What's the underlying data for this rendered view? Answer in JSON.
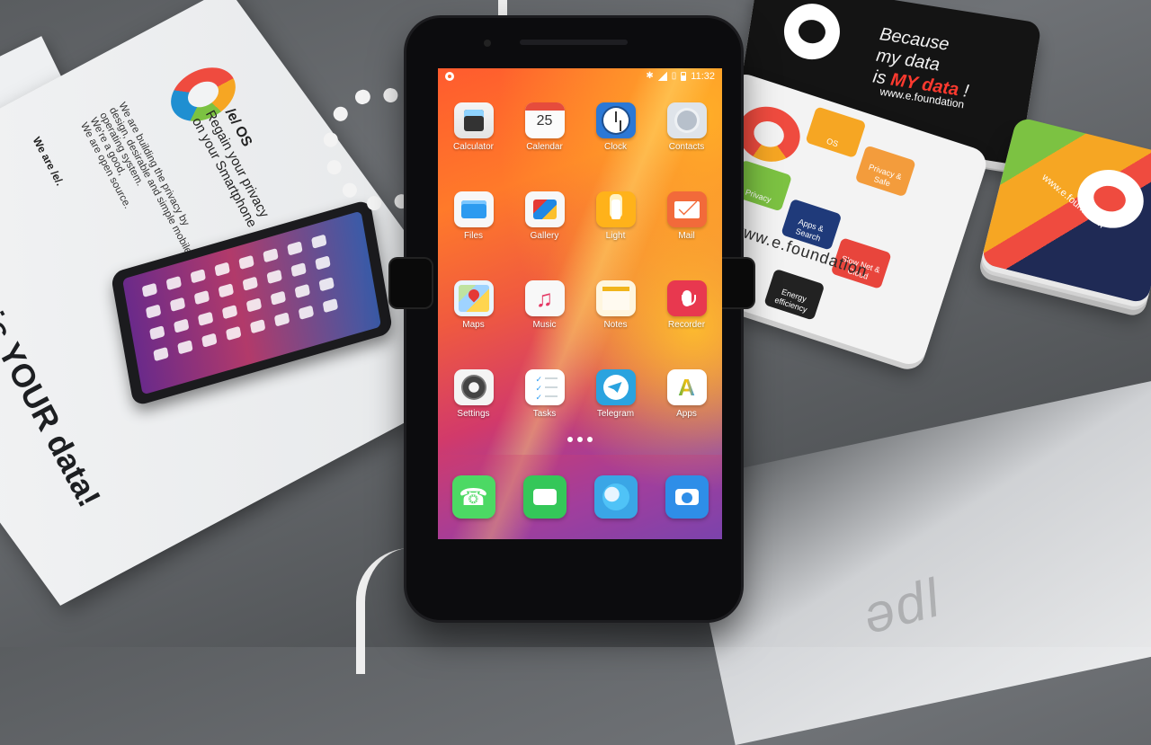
{
  "scene": {
    "description_free": true
  },
  "brochure": {
    "title": "/e/ OS",
    "slogan": "Regain your privacy\non your Smartphone",
    "body": "We are building the privacy by\ndesign, desirable and simple mobile\noperating system.\nWe're a good,\nWe are open source.",
    "we_are": "We are /e/.",
    "big_text": "is YOUR data!"
  },
  "sticker_black": {
    "handwriting_line1": "Because",
    "handwriting_line2": "my data",
    "handwriting_line3_prefix": "is",
    "handwriting_highlight": "MY data",
    "handwriting_suffix": "!",
    "url": "www.e.foundation"
  },
  "sticker_white": {
    "url": "www.e.foundation",
    "tiles": [
      {
        "label": "OS",
        "color": "#f6a623"
      },
      {
        "label": "Privacy & Safe",
        "color": "#f39c3c"
      },
      {
        "label": "Privacy",
        "color": "#7cc242"
      },
      {
        "label": "Apps & Search",
        "color": "#1f3a7a"
      },
      {
        "label": "Slow Net & Cloud",
        "color": "#e8453c"
      },
      {
        "label": "Energy efficiency",
        "color": "#222222"
      }
    ]
  },
  "sticker_stack": {
    "url": "www.e.foundation"
  },
  "phone": {
    "status_bar": {
      "time": "11:32"
    },
    "apps": [
      {
        "label": "Calculator",
        "icon": "calculator-icon",
        "class": "ic-calc"
      },
      {
        "label": "Calendar",
        "icon": "calendar-icon",
        "class": "ic-cal",
        "date": "25"
      },
      {
        "label": "Clock",
        "icon": "clock-icon",
        "class": "ic-clock"
      },
      {
        "label": "Contacts",
        "icon": "contacts-icon",
        "class": "ic-contacts"
      },
      {
        "label": "Files",
        "icon": "folder-icon",
        "class": "ic-files"
      },
      {
        "label": "Gallery",
        "icon": "gallery-icon",
        "class": "ic-gallery"
      },
      {
        "label": "Light",
        "icon": "flashlight-icon",
        "class": "ic-light"
      },
      {
        "label": "Mail",
        "icon": "mail-icon",
        "class": "ic-mail"
      },
      {
        "label": "Maps",
        "icon": "maps-icon",
        "class": "ic-maps"
      },
      {
        "label": "Music",
        "icon": "music-icon",
        "class": "ic-music"
      },
      {
        "label": "Notes",
        "icon": "notes-icon",
        "class": "ic-notes"
      },
      {
        "label": "Recorder",
        "icon": "microphone-icon",
        "class": "ic-recorder"
      },
      {
        "label": "Settings",
        "icon": "settings-gear-icon",
        "class": "ic-settings"
      },
      {
        "label": "Tasks",
        "icon": "tasks-checklist-icon",
        "class": "ic-tasks"
      },
      {
        "label": "Telegram",
        "icon": "telegram-icon",
        "class": "ic-telegram"
      },
      {
        "label": "Apps",
        "icon": "app-store-icon",
        "class": "ic-apps"
      }
    ],
    "dock": [
      {
        "icon": "phone-dialer-icon",
        "class": "dk-phone"
      },
      {
        "icon": "messages-icon",
        "class": "dk-msg"
      },
      {
        "icon": "browser-globe-icon",
        "class": "dk-browser"
      },
      {
        "icon": "camera-icon",
        "class": "dk-camera"
      }
    ],
    "page_indicator_count": 3
  }
}
